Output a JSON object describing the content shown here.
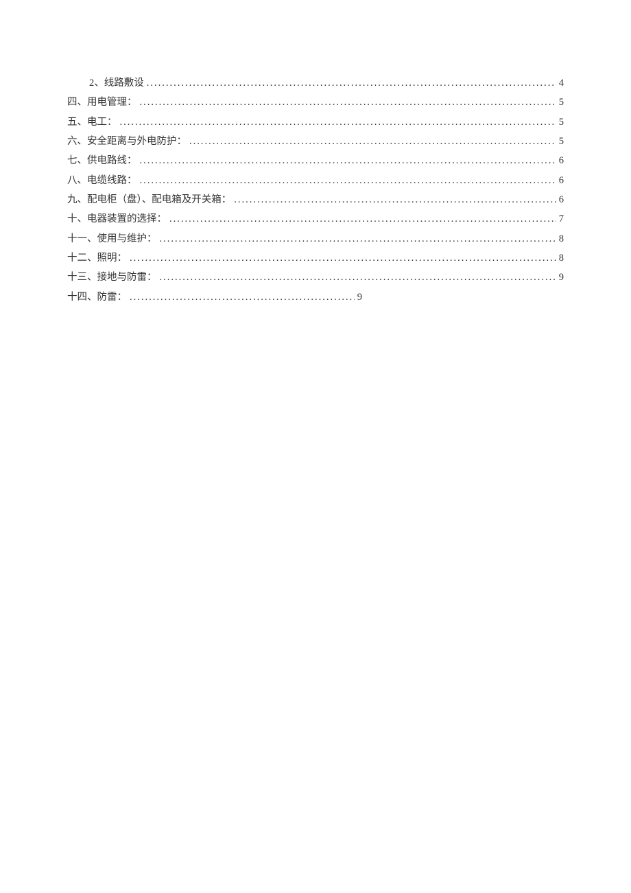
{
  "toc": [
    {
      "label": "2、线路敷设",
      "page": "4",
      "indented": true,
      "short": false
    },
    {
      "label": "四、用电管理：",
      "page": "5",
      "indented": false,
      "short": false
    },
    {
      "label": "五、电工：",
      "page": "5",
      "indented": false,
      "short": false
    },
    {
      "label": "六、安全距离与外电防护：",
      "page": "5",
      "indented": false,
      "short": false
    },
    {
      "label": "七、供电路线：",
      "page": "6",
      "indented": false,
      "short": false
    },
    {
      "label": "八、电缆线路：",
      "page": "6",
      "indented": false,
      "short": false
    },
    {
      "label": "九、配电柜（盘）、配电箱及开关箱：",
      "page": "6",
      "indented": false,
      "short": false
    },
    {
      "label": "十、电器装置的选择：",
      "page": "7",
      "indented": false,
      "short": false
    },
    {
      "label": "十一、使用与维护：",
      "page": "8",
      "indented": false,
      "short": false
    },
    {
      "label": "十二、照明：",
      "page": "8",
      "indented": false,
      "short": false
    },
    {
      "label": "十三、接地与防雷：",
      "page": "9",
      "indented": false,
      "short": false
    },
    {
      "label": "十四、防雷：",
      "page": "9",
      "indented": false,
      "short": true
    }
  ]
}
